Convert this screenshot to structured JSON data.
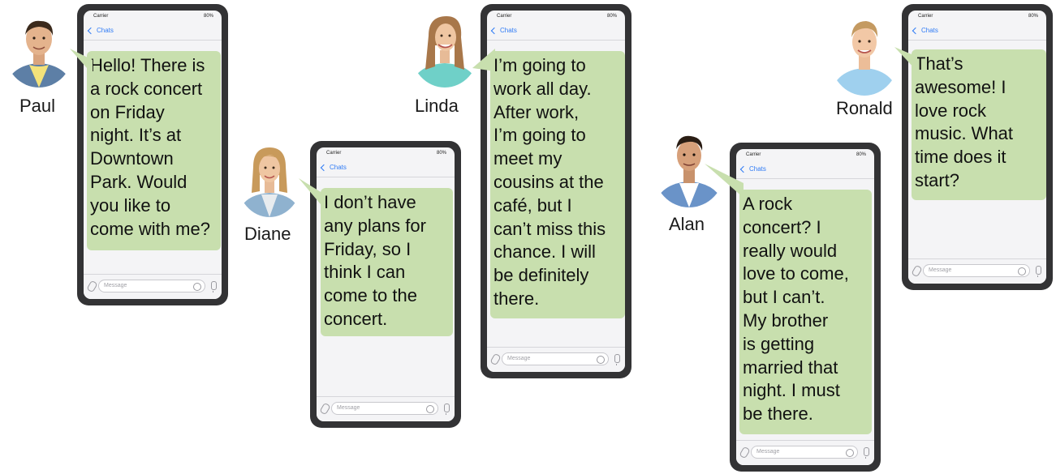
{
  "phone_ui": {
    "carrier": "Carrier",
    "battery": "80%",
    "back_label": "Chats",
    "message_placeholder": "Message"
  },
  "conversation": [
    {
      "name": "Paul",
      "shirt": "#f3e27a",
      "jacket": "#5d7fa6",
      "hair": "#3b2a1c",
      "lines": [
        "Hello! There is",
        "a rock concert",
        "on Friday",
        "night. It’s at",
        "Downtown",
        "Park. Would",
        "you like to",
        "come with me?"
      ]
    },
    {
      "name": "Diane",
      "shirt": "#e8ecef",
      "jacket": "#8fb2cf",
      "hair": "#c89a5b",
      "lines": [
        "I don’t have",
        "any plans for",
        "Friday, so I",
        "think I can",
        "come to the",
        "concert."
      ]
    },
    {
      "name": "Linda",
      "shirt": "#5ec6c0",
      "jacket": "#6fd0c8",
      "hair": "#a8774a",
      "lines": [
        "I’m going to",
        "work all day.",
        "After work,",
        "I’m going to",
        "meet my",
        "cousins at the",
        "café, but I",
        "can’t miss this",
        "chance. I will",
        "be definitely",
        "there."
      ]
    },
    {
      "name": "Alan",
      "shirt": "#ffffff",
      "jacket": "#6a93c8",
      "hair": "#2a1d14",
      "lines": [
        "A rock",
        "concert? I",
        "really would",
        "love to come,",
        "but I can’t.",
        "My brother",
        "is getting",
        "married that",
        "night. I must",
        "be there."
      ]
    },
    {
      "name": "Ronald",
      "shirt": "#9fd0ee",
      "jacket": "#9fd0ee",
      "hair": "#c49a61",
      "lines": [
        "That’s",
        "awesome! I",
        "love rock",
        "music. What",
        "time does it",
        "start?"
      ]
    }
  ],
  "colors": {
    "bubble": "#c8dfae",
    "phone_frame": "#333335",
    "link": "#2f7bf5"
  }
}
